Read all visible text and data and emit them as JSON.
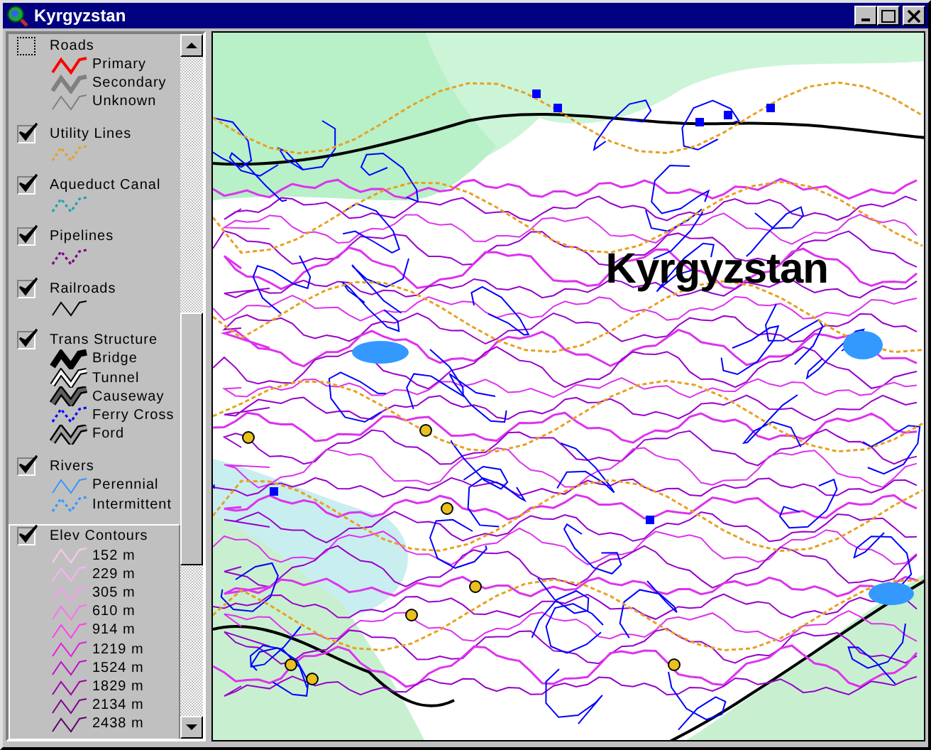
{
  "window": {
    "title": "Kyrgyzstan"
  },
  "legend": [
    {
      "name": "Roads",
      "checked": false,
      "selected": false,
      "entries": [
        {
          "label": "Primary",
          "color": "#ff0000",
          "kind": "medium"
        },
        {
          "label": "Secondary",
          "color": "#808080",
          "kind": "thick"
        },
        {
          "label": "Unknown",
          "color": "#808080",
          "kind": "thin"
        }
      ]
    },
    {
      "name": "Utility Lines",
      "checked": true,
      "selected": false,
      "entries": [
        {
          "color": "#e8a020",
          "kind": "dotted"
        }
      ]
    },
    {
      "name": "Aqueduct Canal",
      "checked": true,
      "selected": false,
      "entries": [
        {
          "color": "#20a0b0",
          "kind": "dotted"
        }
      ]
    },
    {
      "name": "Pipelines",
      "checked": true,
      "selected": false,
      "entries": [
        {
          "color": "#800080",
          "kind": "dotted"
        }
      ]
    },
    {
      "name": "Railroads",
      "checked": true,
      "selected": false,
      "entries": [
        {
          "color": "#000000",
          "kind": "thin"
        }
      ]
    },
    {
      "name": "Trans Structure",
      "checked": true,
      "selected": false,
      "entries": [
        {
          "label": "Bridge",
          "color": "#000000",
          "kind": "heavy"
        },
        {
          "label": "Tunnel",
          "color": "#000000",
          "kind": "hollow"
        },
        {
          "label": "Causeway",
          "color": "#606060",
          "kind": "cased"
        },
        {
          "label": "Ferry Cross",
          "color": "#0000ff",
          "kind": "dotted"
        },
        {
          "label": "Ford",
          "color": "#a0a0a0",
          "kind": "cased"
        }
      ]
    },
    {
      "name": "Rivers",
      "checked": true,
      "selected": false,
      "entries": [
        {
          "label": "Perennial",
          "color": "#3399ff",
          "kind": "thin"
        },
        {
          "label": "Intermittent",
          "color": "#3399ff",
          "kind": "dotted"
        }
      ]
    },
    {
      "name": "Elev Contours",
      "checked": true,
      "selected": true,
      "entries": [
        {
          "label": "152 m",
          "color": "#ffc8f0",
          "kind": "thin"
        },
        {
          "label": "229 m",
          "color": "#ffb0f0",
          "kind": "thin"
        },
        {
          "label": "305 m",
          "color": "#ff98f0",
          "kind": "thin"
        },
        {
          "label": "610 m",
          "color": "#ff70f0",
          "kind": "thin"
        },
        {
          "label": "914 m",
          "color": "#ff40f0",
          "kind": "thin"
        },
        {
          "label": "1219 m",
          "color": "#e020e0",
          "kind": "thin"
        },
        {
          "label": "1524 m",
          "color": "#c010c8",
          "kind": "thin"
        },
        {
          "label": "1829 m",
          "color": "#a000a8",
          "kind": "thin"
        },
        {
          "label": "2134 m",
          "color": "#800090",
          "kind": "thin"
        },
        {
          "label": "2438 m",
          "color": "#600070",
          "kind": "thin"
        }
      ]
    }
  ],
  "map": {
    "label": "Kyrgyzstan"
  }
}
